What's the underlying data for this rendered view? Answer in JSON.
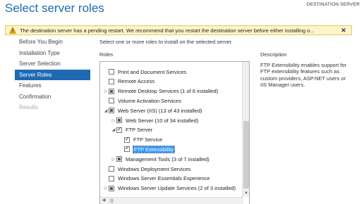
{
  "header": {
    "title": "Select server roles",
    "destination": "DESTINATION SERVER"
  },
  "warning": {
    "text": "The destination server has a pending restart. We recommend that you restart the destination server before either installing o...",
    "close": "✕"
  },
  "nav": {
    "items": [
      {
        "label": "Before You Begin",
        "state": "normal"
      },
      {
        "label": "Installation Type",
        "state": "normal"
      },
      {
        "label": "Server Selection",
        "state": "normal"
      },
      {
        "label": "Server Roles",
        "state": "active"
      },
      {
        "label": "Features",
        "state": "normal"
      },
      {
        "label": "Confirmation",
        "state": "normal"
      },
      {
        "label": "Results",
        "state": "disabled"
      }
    ]
  },
  "main": {
    "instruction": "Select one or more roles to install on the selected server.",
    "roles_label": "Roles",
    "description_label": "Description",
    "description_text": "FTP Extensibility enables support for FTP extensibility features such as custom providers, ASP.NET users or IIS Manager users."
  },
  "roles": [
    {
      "label": "Print and Document Services",
      "indent": 0,
      "expander": "",
      "check": "none"
    },
    {
      "label": "Remote Access",
      "indent": 0,
      "expander": "",
      "check": "none"
    },
    {
      "label": "Remote Desktop Services (1 of 6 installed)",
      "indent": 0,
      "expander": "▷",
      "check": "partial"
    },
    {
      "label": "Volume Activation Services",
      "indent": 0,
      "expander": "",
      "check": "none"
    },
    {
      "label": "Web Server (IIS) (13 of 43 installed)",
      "indent": 0,
      "expander": "◢",
      "check": "partial"
    },
    {
      "label": "Web Server (10 of 34 installed)",
      "indent": 1,
      "expander": "▷",
      "check": "partial"
    },
    {
      "label": "FTP Server",
      "indent": 1,
      "expander": "◢",
      "check": "checked"
    },
    {
      "label": "FTP Service",
      "indent": 2,
      "expander": "",
      "check": "checked"
    },
    {
      "label": "FTP Extensibility",
      "indent": 2,
      "expander": "",
      "check": "checked",
      "selected": true
    },
    {
      "label": "Management Tools (3 of 7 installed)",
      "indent": 1,
      "expander": "▷",
      "check": "partial"
    },
    {
      "label": "Windows Deployment Services",
      "indent": 0,
      "expander": "",
      "check": "none"
    },
    {
      "label": "Windows Server Essentials Experience",
      "indent": 0,
      "expander": "",
      "check": "none"
    },
    {
      "label": "Windows Server Update Services (2 of 3 installed)",
      "indent": 0,
      "expander": "▷",
      "check": "partial"
    }
  ],
  "colors": {
    "accent": "#1e6ab3",
    "warning_bg": "#fdf5c9",
    "selection": "#3399ff"
  }
}
